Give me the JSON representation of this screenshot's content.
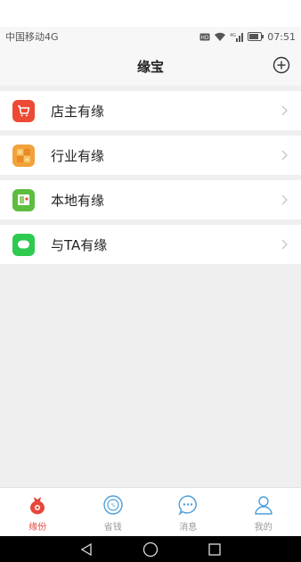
{
  "status": {
    "carrier": "中国移动4G",
    "time": "07:51",
    "network": "4G",
    "icons": [
      "hd-icon",
      "wifi-icon",
      "signal-icon",
      "battery-icon"
    ]
  },
  "header": {
    "title": "缘宝",
    "add_icon": "plus-circle-icon"
  },
  "list": {
    "items": [
      {
        "label": "店主有缘",
        "icon": "shop-cart-icon",
        "color": "#ec4a34"
      },
      {
        "label": "行业有缘",
        "icon": "calculator-icon",
        "color": "#f2a23a"
      },
      {
        "label": "本地有缘",
        "icon": "map-icon",
        "color": "#5cbd3f"
      },
      {
        "label": "与TA有缘",
        "icon": "chat-bubble-icon",
        "color": "#2ec94f"
      }
    ]
  },
  "tabbar": {
    "active_color": "#e5473b",
    "inactive_color": "#4a9fd8",
    "tabs": [
      {
        "label": "缘份",
        "icon": "fortune-bag-icon",
        "active": true
      },
      {
        "label": "省钱",
        "icon": "discount-icon",
        "active": false
      },
      {
        "label": "消息",
        "icon": "message-icon",
        "active": false
      },
      {
        "label": "我的",
        "icon": "user-icon",
        "active": false
      }
    ]
  },
  "navbar": {
    "buttons": [
      "back-icon",
      "home-icon",
      "recents-icon"
    ]
  }
}
